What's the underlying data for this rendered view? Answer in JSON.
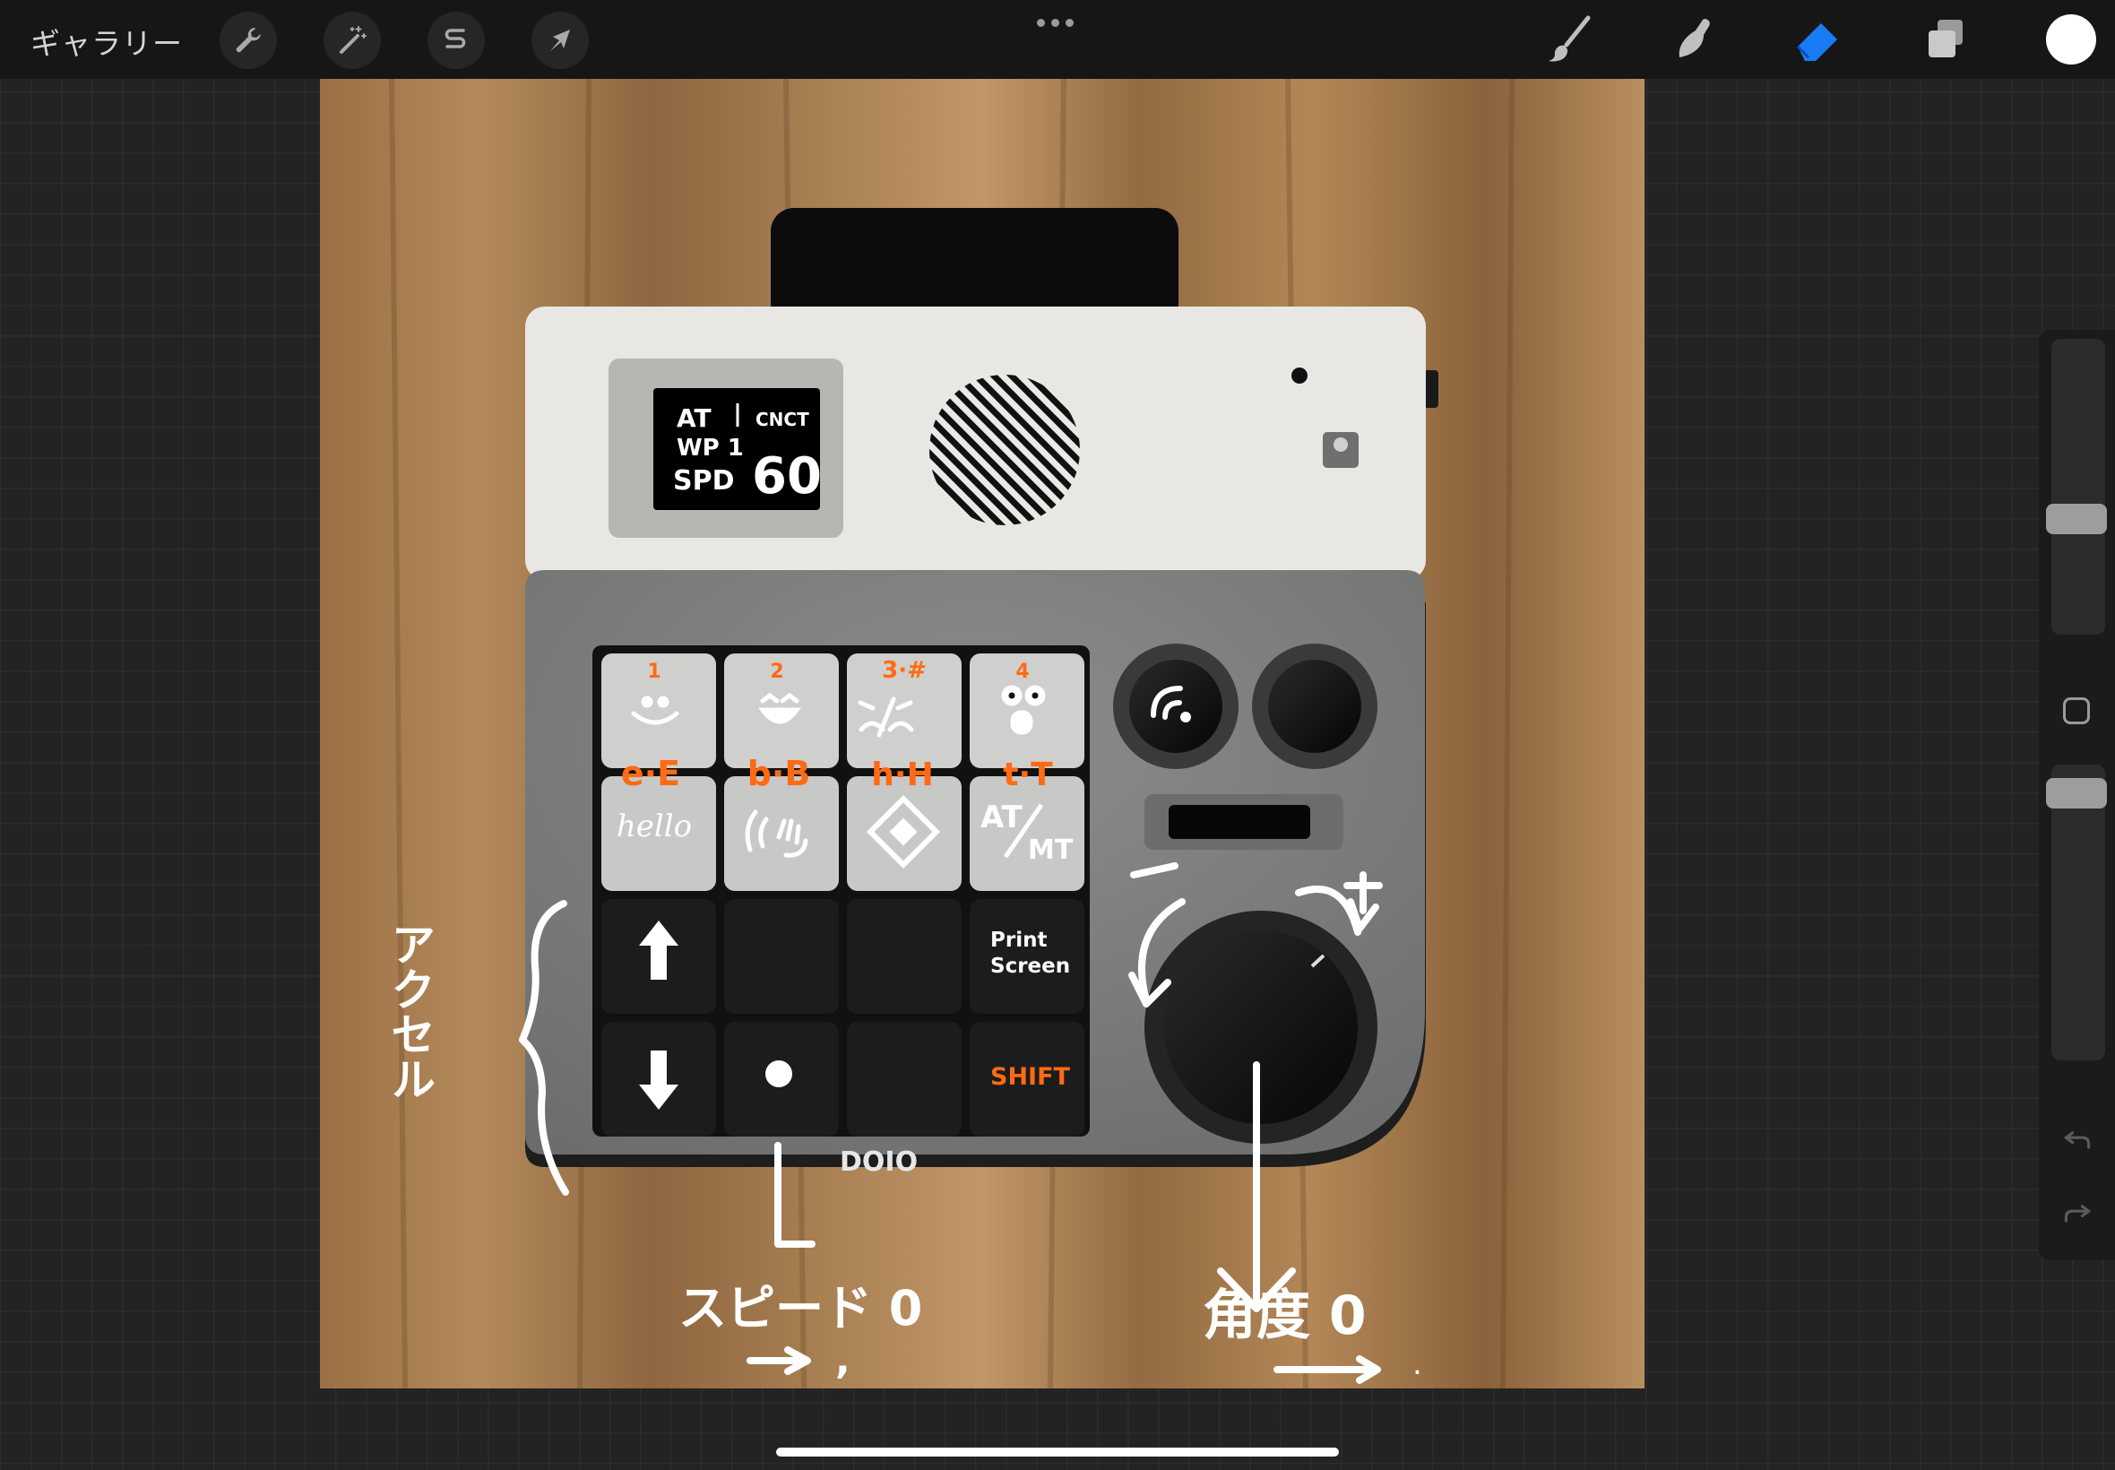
{
  "toolbar": {
    "gallery_label": "ギャラリー",
    "left_tools": [
      "wrench-icon",
      "magic-wand-icon",
      "selection-s-icon",
      "transform-arrow-icon"
    ],
    "right_tools": [
      "brush-icon",
      "smudge-icon",
      "eraser-icon",
      "layers-icon"
    ],
    "active_tool": "eraser",
    "accent_color": "#1a7cf5",
    "current_color": "#ffffff"
  },
  "artwork": {
    "oled": {
      "line1_left": "AT",
      "line1_right": "CNCT",
      "line2": "WP 1",
      "line3_left": "SPD",
      "line3_right": "60"
    },
    "keys_top": [
      {
        "number": "1",
        "glyph": "smile"
      },
      {
        "number": "2",
        "glyph": "grin"
      },
      {
        "number": "3·#",
        "glyph": "angry"
      },
      {
        "number": "4",
        "glyph": "surprised"
      }
    ],
    "keys_row2_labels": [
      "e·E",
      "b·B",
      "h·H",
      "t·T"
    ],
    "key_hello": "hello",
    "key_atmt_top": "AT",
    "key_atmt_bottom": "MT",
    "key_print_line1": "Print",
    "key_print_line2": "Screen",
    "key_shift": "SHIFT",
    "brand": "DOIO",
    "note_accel": "アクセル",
    "note_speed": "スピード 0",
    "note_angle": "角度 0",
    "note_speed_arrow_char": ",",
    "note_angle_arrow_char": "."
  },
  "colors": {
    "orange_ink": "#ff6a13",
    "white_ink": "#ffffff",
    "wood": "#a27a4e"
  },
  "sidebar": {
    "size_level": 0.38,
    "opacity_level": 0.95,
    "icons": [
      "modify-square-icon",
      "undo-icon",
      "redo-icon"
    ]
  }
}
